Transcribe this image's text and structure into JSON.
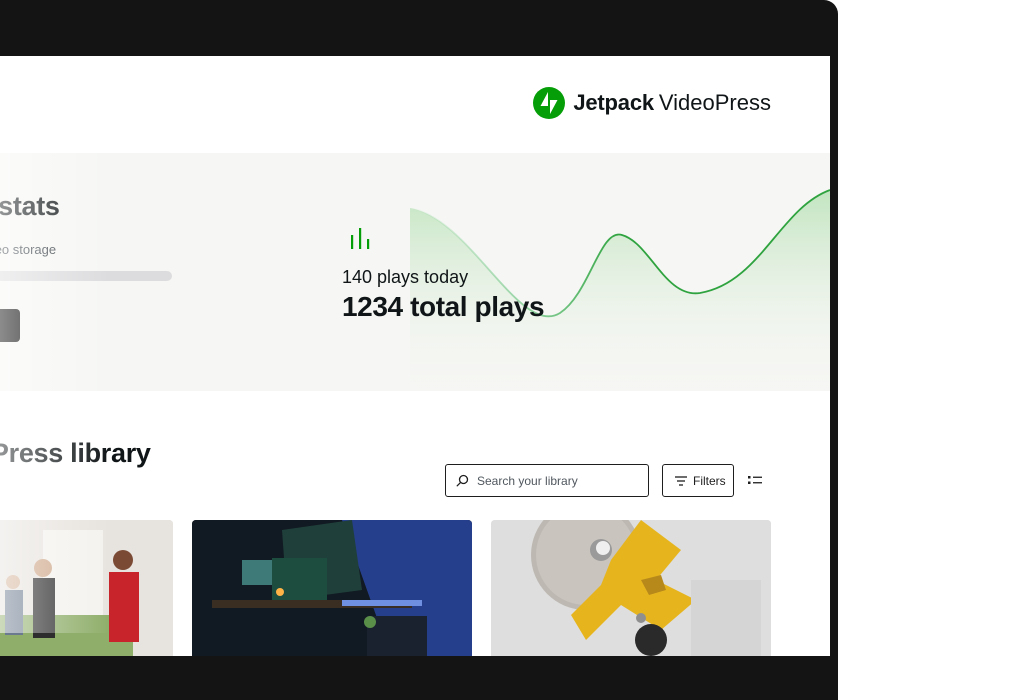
{
  "brand": {
    "name_bold": "Jetpack",
    "name_regular": "VideoPress",
    "logo_icon": "jetpack-bolt-icon",
    "logo_color": "#069e08"
  },
  "stats": {
    "title": "eo stats",
    "storage_label": "ud video storage",
    "storage_used_fraction": 0.02,
    "stats_icon": "bar-chart-icon",
    "plays_today": "140 plays today",
    "total_plays": "1234 total plays",
    "accent_color": "#069e08"
  },
  "library": {
    "title": "eoPress library",
    "search": {
      "placeholder": "Search your library",
      "value": ""
    },
    "filters_label": "Filters",
    "list_view_icon": "list-view-icon",
    "videos": [
      {
        "thumbnail": "people-gathered-around-table"
      },
      {
        "thumbnail": "desk-with-monitors-and-blue-lighting"
      },
      {
        "thumbnail": "gold-and-terrazzo-sculpture"
      }
    ]
  }
}
